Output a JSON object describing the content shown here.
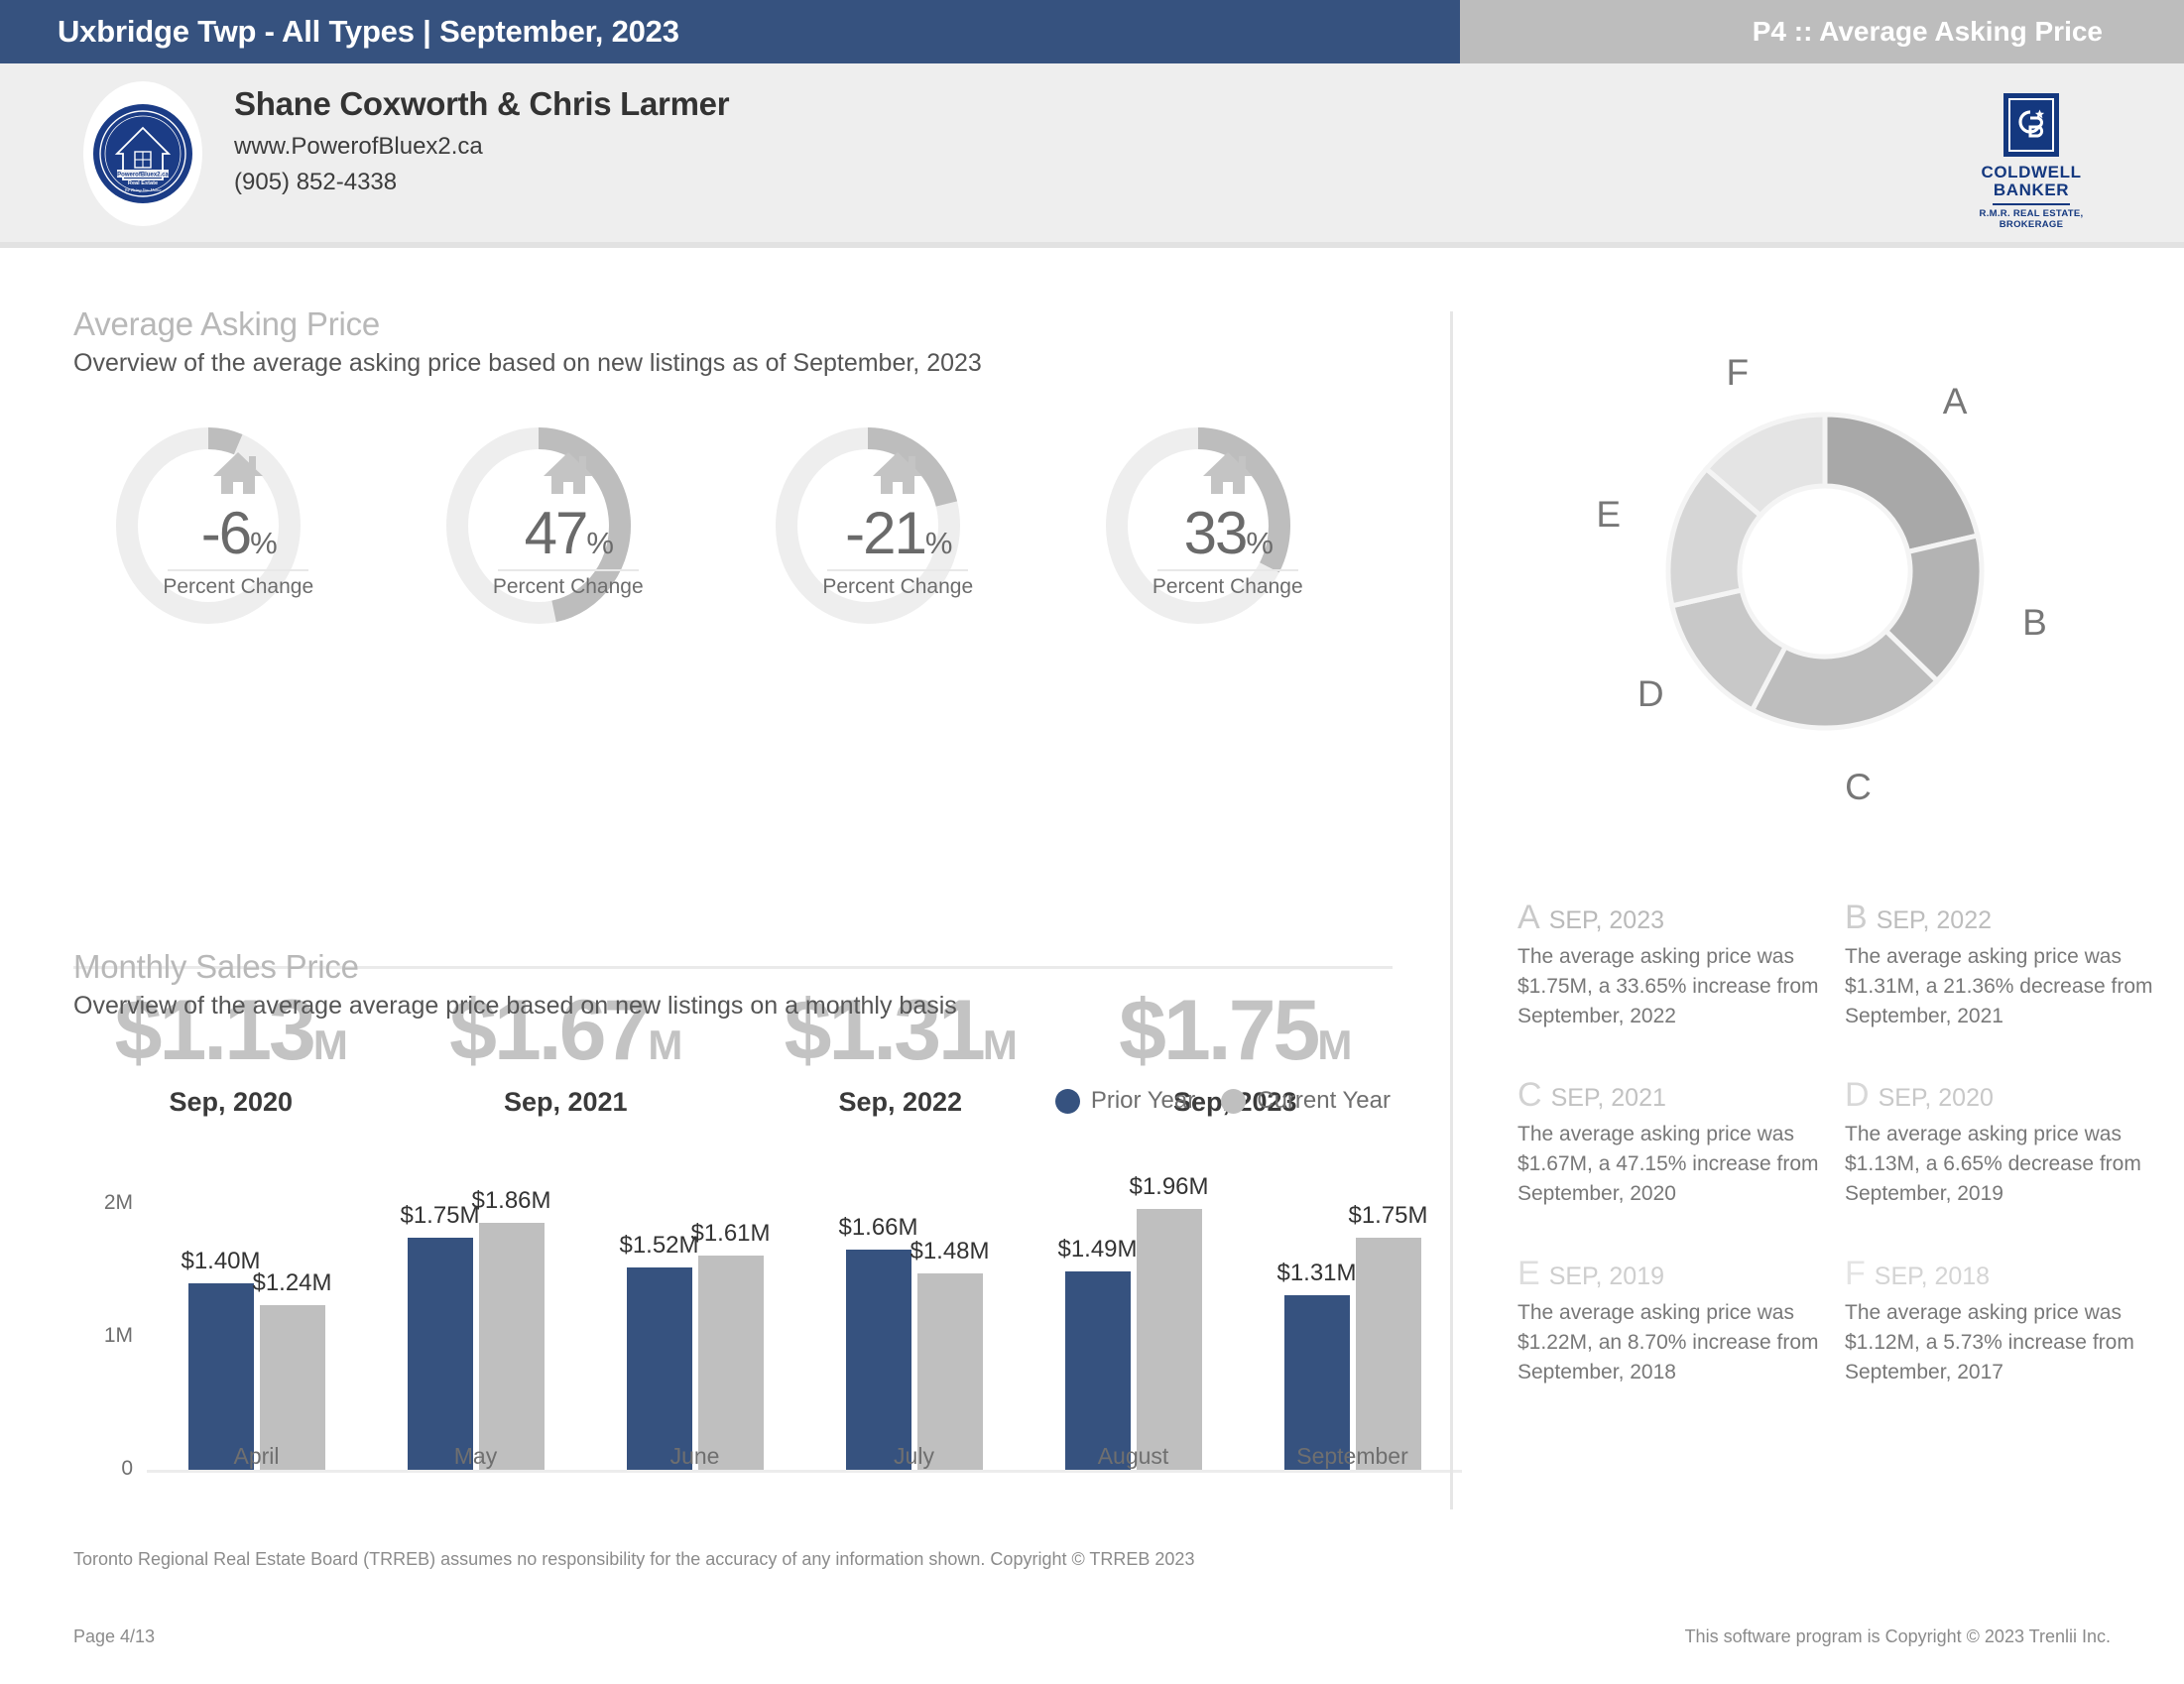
{
  "header": {
    "title": "Uxbridge Twp - All Types | September, 2023",
    "page_label": "P4 :: Average Asking Price",
    "bar_color": "#36527f",
    "accent_gray": "#bdbdbd"
  },
  "agent": {
    "name": "Shane Coxworth & Chris Larmer",
    "website": "www.PowerofBluex2.ca",
    "phone": "(905) 852-4338",
    "logo_icon": "powerofbluex2-seal-logo",
    "brokerage": {
      "monogram": "CB",
      "line1": "COLDWELL",
      "line2": "BANKER",
      "sub1": "R.M.R. REAL ESTATE,",
      "sub2": "BROKERAGE",
      "color": "#14387f"
    }
  },
  "average_asking_price": {
    "title": "Average Asking Price",
    "subtitle": "Overview of the average asking price based on new listings as of September, 2023",
    "metric_label": "Percent Change",
    "gauges": [
      {
        "display": "-6",
        "unit": "%",
        "magnitude": 6,
        "price": "$1.13",
        "suffix": "M",
        "date": "Sep, 2020"
      },
      {
        "display": "47",
        "unit": "%",
        "magnitude": 47,
        "price": "$1.67",
        "suffix": "M",
        "date": "Sep, 2021"
      },
      {
        "display": "-21",
        "unit": "%",
        "magnitude": 21,
        "price": "$1.31",
        "suffix": "M",
        "date": "Sep, 2022"
      },
      {
        "display": "33",
        "unit": "%",
        "magnitude": 33,
        "price": "$1.75",
        "suffix": "M",
        "date": "Sep, 2023"
      }
    ]
  },
  "monthly_sales_price": {
    "title": "Monthly Sales Price",
    "subtitle": "Overview of the average average price based on new listings on a monthly basis"
  },
  "chart_data": {
    "type": "bar",
    "title": "Monthly Sales Price",
    "subtitle": "Overview of the average average price based on new listings on a monthly basis",
    "xlabel": "",
    "ylabel": "",
    "ylim": [
      0,
      2000000
    ],
    "yticks": [
      "0",
      "1M",
      "2M"
    ],
    "ytick_values": [
      0,
      1000000,
      2000000
    ],
    "grid": false,
    "legend_position": "top-right",
    "categories": [
      "April",
      "May",
      "June",
      "July",
      "August",
      "September"
    ],
    "series": [
      {
        "name": "Prior Year",
        "color": "#36527f",
        "values": [
          1400000,
          1750000,
          1520000,
          1660000,
          1490000,
          1310000
        ],
        "labels": [
          "$1.40M",
          "$1.75M",
          "$1.52M",
          "$1.66M",
          "$1.49M",
          "$1.31M"
        ]
      },
      {
        "name": "Current Year",
        "color": "#bfbfbf",
        "values": [
          1240000,
          1860000,
          1610000,
          1480000,
          1960000,
          1750000
        ],
        "labels": [
          "$1.24M",
          "$1.86M",
          "$1.61M",
          "$1.48M",
          "$1.96M",
          "$1.75M"
        ]
      }
    ]
  },
  "donut": {
    "type": "pie",
    "labels": [
      "A",
      "B",
      "C",
      "D",
      "E",
      "F"
    ],
    "values": [
      1.75,
      1.31,
      1.67,
      1.13,
      1.22,
      1.12
    ],
    "colors": [
      "#a8a8a8",
      "#b3b3b3",
      "#bdbdbd",
      "#c8c8c8",
      "#d6d6d6",
      "#e4e4e4"
    ]
  },
  "cards": [
    {
      "letter": "A",
      "period": "SEP, 2023",
      "text": "The average asking price was $1.75M, a 33.65% increase from September, 2022",
      "letter_color": "#c9c9c9",
      "period_color": "#b9b9b9"
    },
    {
      "letter": "B",
      "period": "SEP, 2022",
      "text": "The average asking price was $1.31M, a 21.36% decrease from September, 2021",
      "letter_color": "#cdcdcd",
      "period_color": "#bdbdbd"
    },
    {
      "letter": "C",
      "period": "SEP, 2021",
      "text": "The average asking price was $1.67M, a 47.15% increase from September, 2020",
      "letter_color": "#d2d2d2",
      "period_color": "#c2c2c2"
    },
    {
      "letter": "D",
      "period": "SEP, 2020",
      "text": "The average asking price was $1.13M, a 6.65% decrease from September, 2019",
      "letter_color": "#d8d8d8",
      "period_color": "#c8c8c8"
    },
    {
      "letter": "E",
      "period": "SEP, 2019",
      "text": "The average asking price was $1.22M, an 8.70% increase from September, 2018",
      "letter_color": "#dedede",
      "period_color": "#cecece"
    },
    {
      "letter": "F",
      "period": "SEP, 2018",
      "text": "The average asking price was $1.12M, a 5.73% increase from September, 2017",
      "letter_color": "#e4e4e4",
      "period_color": "#d4d4d4"
    }
  ],
  "footer": {
    "disclaimer": "Toronto Regional Real Estate Board (TRREB) assumes no responsibility for the accuracy of any information shown. Copyright © TRREB 2023",
    "page": "Page 4/13",
    "software": "This software program is Copyright © 2023 Trenlii Inc."
  }
}
